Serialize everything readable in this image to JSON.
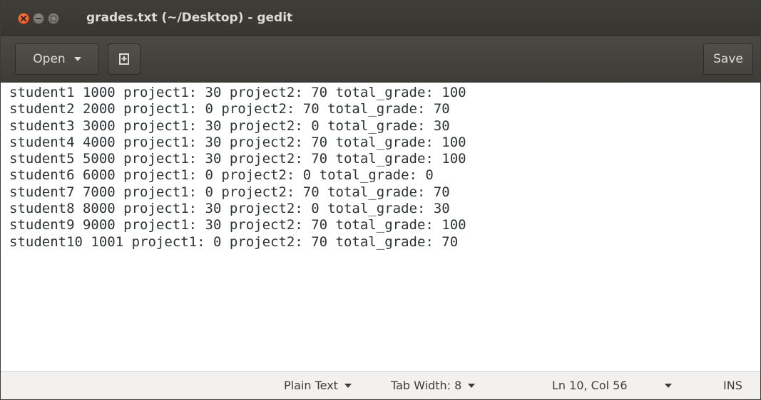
{
  "window": {
    "title": "grades.txt (~/Desktop) - gedit"
  },
  "toolbar": {
    "open_label": "Open",
    "new_doc_icon": "new-document-icon",
    "save_label": "Save"
  },
  "document": {
    "lines": [
      "student1 1000 project1: 30 project2: 70 total_grade: 100",
      "student2 2000 project1: 0 project2: 70 total_grade: 70",
      "student3 3000 project1: 30 project2: 0 total_grade: 30",
      "student4 4000 project1: 30 project2: 70 total_grade: 100",
      "student5 5000 project1: 30 project2: 70 total_grade: 100",
      "student6 6000 project1: 0 project2: 0 total_grade: 0",
      "student7 7000 project1: 0 project2: 70 total_grade: 70",
      "student8 8000 project1: 30 project2: 0 total_grade: 30",
      "student9 9000 project1: 30 project2: 70 total_grade: 100",
      "student10 1001 project1: 0 project2: 70 total_grade: 70"
    ]
  },
  "statusbar": {
    "language": "Plain Text",
    "tab_width": "Tab Width: 8",
    "cursor_position": "Ln 10, Col 56",
    "insert_mode": "INS"
  },
  "colors": {
    "titlebar_bg": "#3c3b37",
    "toolbar_bg": "#454440",
    "close_button": "#e95420",
    "editor_text": "#2e3436",
    "statusbar_bg": "#f2f1f0"
  }
}
